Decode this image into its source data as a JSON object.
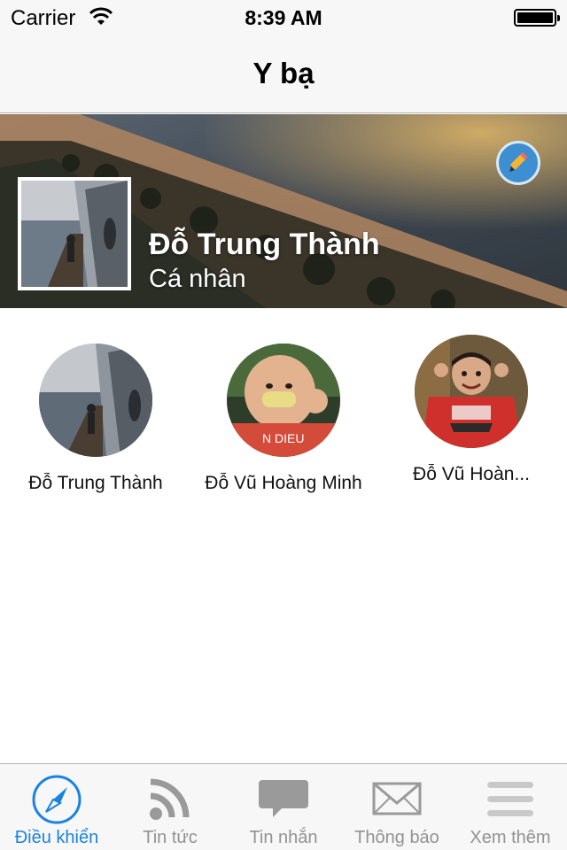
{
  "status_bar": {
    "carrier": "Carrier",
    "time": "8:39 AM",
    "battery_level": 1.0
  },
  "nav": {
    "title": "Y bạ"
  },
  "profile": {
    "name": "Đỗ Trung Thành",
    "type": "Cá nhân"
  },
  "accounts": [
    {
      "name": "Đỗ Trung Thành"
    },
    {
      "name": "Đỗ Vũ Hoàng Minh"
    },
    {
      "name": "Đỗ Vũ Hoàn..."
    }
  ],
  "tabs": [
    {
      "label": "Điều khiển",
      "icon": "compass-icon",
      "active": true
    },
    {
      "label": "Tin tức",
      "icon": "rss-icon",
      "active": false
    },
    {
      "label": "Tin nhắn",
      "icon": "chat-bubble-icon",
      "active": false
    },
    {
      "label": "Thông báo",
      "icon": "envelope-icon",
      "active": false
    },
    {
      "label": "Xem thêm",
      "icon": "menu-icon",
      "active": false
    }
  ],
  "colors": {
    "accent": "#1a82e0",
    "tab_inactive": "#929292",
    "edit_button": "#3d8fd1"
  }
}
